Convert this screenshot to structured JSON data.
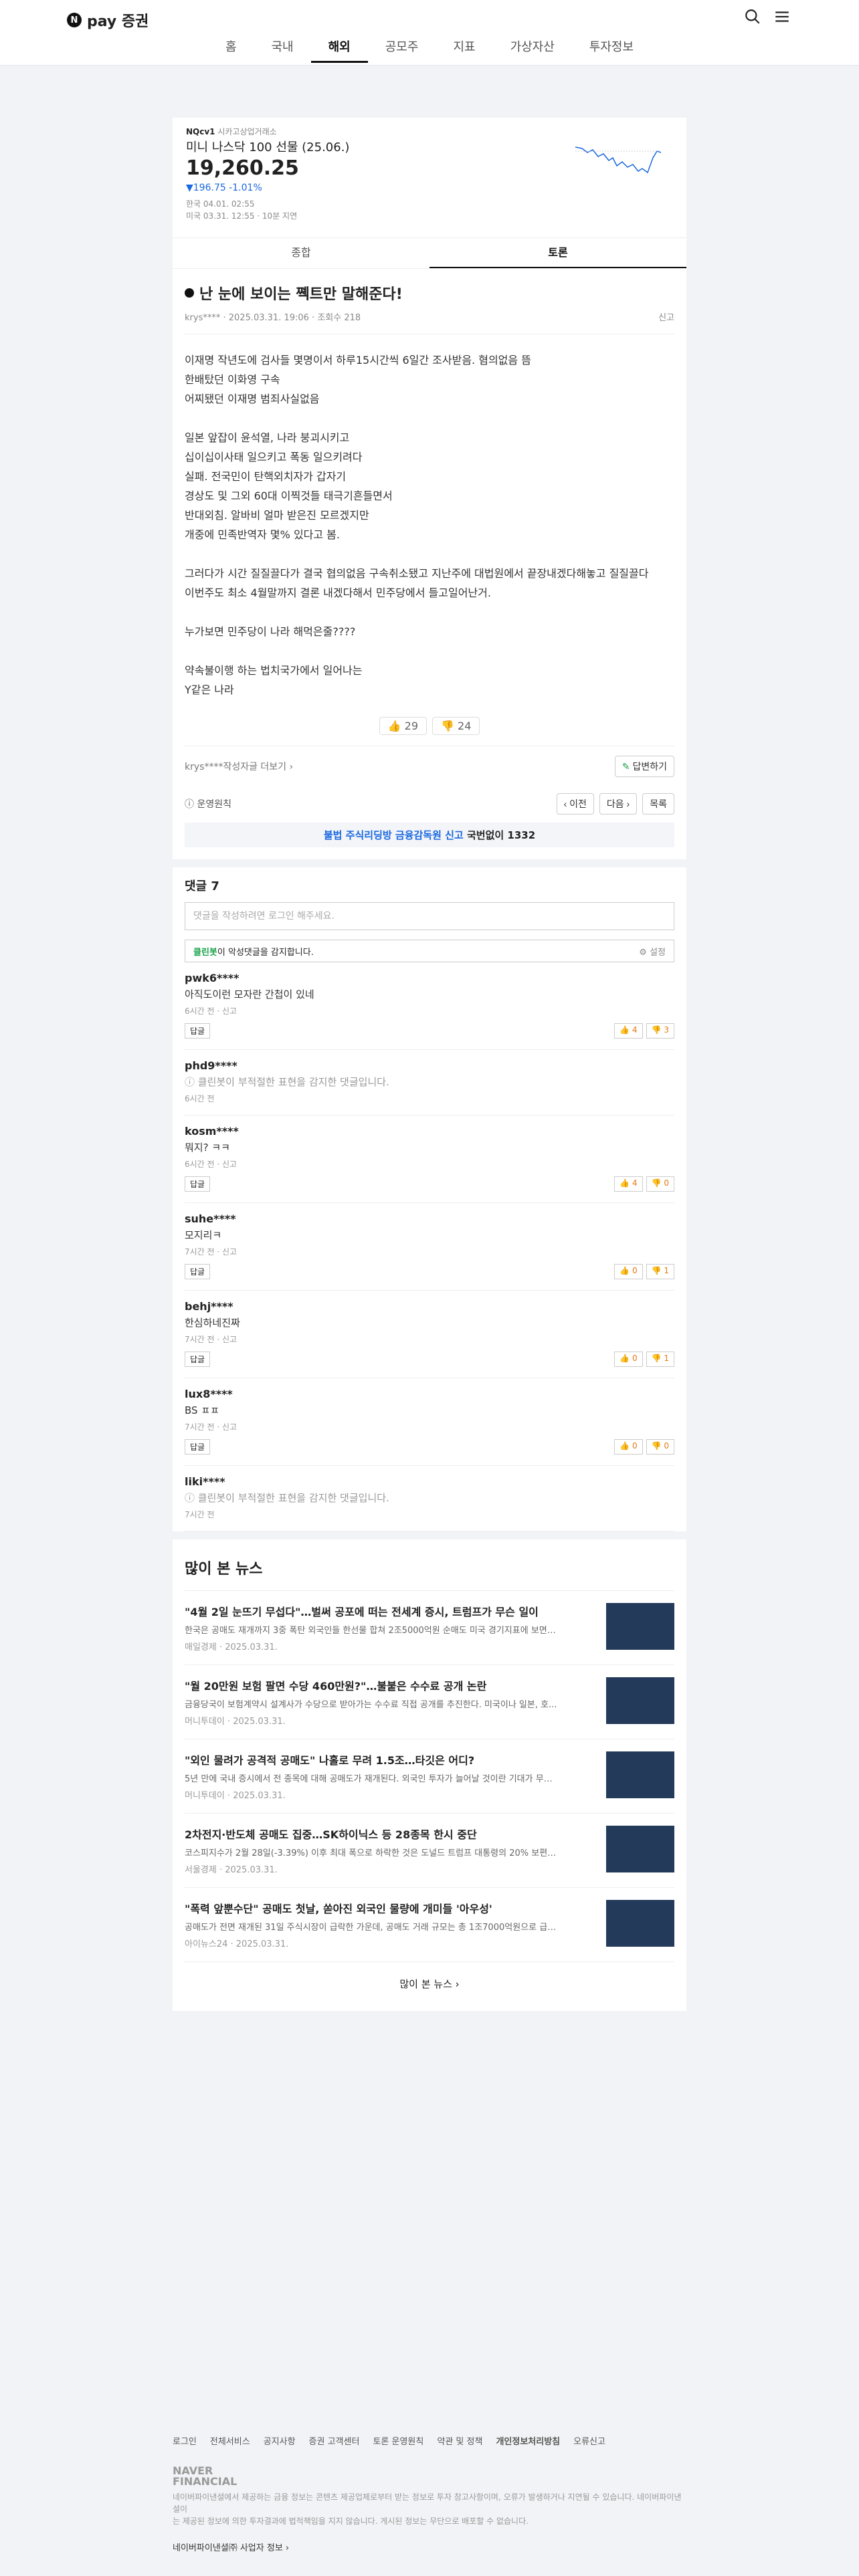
{
  "brand": {
    "logo_letter": "N",
    "name": "pay 증권"
  },
  "nav": [
    "홈",
    "국내",
    "해외",
    "공모주",
    "지표",
    "가상자산",
    "투자정보"
  ],
  "stock": {
    "code": "NQcv1",
    "tag": "시카고상업거래소",
    "name": "미니 나스닥 100 선물 (25.06.)",
    "price": "19,260.25",
    "change": "▼196.75",
    "rate": "-1.01%",
    "time_kr": "한국 04.01. 02:55",
    "time_us": "미국 03.31. 12:55",
    "delay": "10분 지연",
    "line_color": "#1a68e0"
  },
  "tabs": [
    "종합",
    "토론"
  ],
  "post": {
    "title": "난 눈에 보이는 쪡트만 말해준다!",
    "author": "krys****",
    "date": "2025.03.31. 19:06",
    "views": "조회수 218",
    "report": "신고",
    "body": "이재명 작년도에 검사들 몇명이서 하루15시간씩 6일간 조사받음. 혐의없음 뜸\n한배탔던 이화영 구속\n어찌됐던 이재명 범죄사실없음\n\n일본 앞잡이 윤석열, 나라 붕괴시키고\n십이십이사태 일으키고 폭동 일으키려다\n실패. 전국민이 탄핵외치자가 갑자기\n경상도 및 그외 60대 이찍것들 태극기흔들면서\n반대외침. 알바비 얼마 받은진 모르겠지만\n개중에 민족반역자 몇% 있다고 봄.\n\n그러다가 시간 질질끌다가 결국 협의없음 구속취소됐고 지난주에 대법원에서 끝장내겠다해놓고 질질끌다\n이번주도 최소 4월말까지 결론 내겠다해서 민주당에서 들고일어난거.\n\n누가보면 민주당이 나라 해먹은줄????\n\n약속불이행 하는 법치국가에서 일어나는\nY같은 나라",
    "up": "29",
    "down": "24",
    "more": "krys****작성자글 더보기",
    "reply": "답변하기",
    "policy": "운영원칙",
    "prev": "이전",
    "next": "다음",
    "list": "목록",
    "warn_a": "불법 주식리딩방 금융감독원 신고",
    "warn_b": "국번없이 1332"
  },
  "comments": {
    "title": "댓글 7",
    "placeholder": "댓글을 작성하려면 로그인 해주세요.",
    "clean": "클린봇",
    "clean_text": "이 악성댓글을 감지합니다.",
    "setting": "설정",
    "items": [
      {
        "user": "pwk6****",
        "text": "아직도이런 모자란 간첩이 있네",
        "time": "6시간 전 · 신고",
        "reply": "답글",
        "up": "4",
        "down": "3"
      },
      {
        "user": "phd9****",
        "text": "ⓘ 클린봇이 부적절한 표현을 감지한 댓글입니다.",
        "time": "6시간 전",
        "hidden": true
      },
      {
        "user": "kosm****",
        "text": "뭐지? ㅋㅋ",
        "time": "6시간 전 · 신고",
        "reply": "답글",
        "up": "4",
        "down": "0"
      },
      {
        "user": "suhe****",
        "text": "모지리ㅋ",
        "time": "7시간 전 · 신고",
        "reply": "답글",
        "up": "0",
        "down": "1"
      },
      {
        "user": "behj****",
        "text": "한심하네진짜",
        "time": "7시간 전 · 신고",
        "reply": "답글",
        "up": "0",
        "down": "1"
      },
      {
        "user": "lux8****",
        "text": "BS ㅍㅍ",
        "time": "7시간 전 · 신고",
        "reply": "답글",
        "up": "0",
        "down": "0"
      },
      {
        "user": "liki****",
        "text": "ⓘ 클린봇이 부적절한 표현을 감지한 댓글입니다.",
        "time": "7시간 전",
        "hidden": true
      }
    ]
  },
  "news": {
    "title": "많이 본 뉴스",
    "more": "많이 본 뉴스",
    "items": [
      {
        "t": "\"4월 2일 눈뜨기 무섭다\"…벌써 공포에 떠는 전세계 증시, 트럼프가 무슨 일이",
        "d": "한국은 공매도 재개까지 3중 폭탄 외국인들 한선물 합쳐 2조5000억원 순매도 미국 경기지표에 보면관세...",
        "s": "매일경제 · 2025.03.31."
      },
      {
        "t": "\"월 20만원 보험 팔면 수당 460만원?\"…불붙은 수수료 공개 논란",
        "d": "금융당국이 보험계약시 설계사가 수당으로 받아가는 수수료 직접 공개를 추진한다. 미국이나 일본, 호...",
        "s": "머니투데이 · 2025.03.31."
      },
      {
        "t": "\"외인 물려가 공격적 공매도\" 나홀로 무려 1.5조…타깃은 어디?",
        "d": "5년 만에 국내 증시에서 전 종목에 대해 공매도가 재개된다. 외국인 투자가 늘어날 것이란 기대가 무색하...",
        "s": "머니투데이 · 2025.03.31."
      },
      {
        "t": "2차전지·반도체 공매도 집중…SK하이닉스 등 28종목 한시 중단",
        "d": "코스피지수가 2월 28일(-3.39%) 이후 최대 폭으로 하락한 것은 도널드 트럼프 대통령의 20% 보편관세 ...",
        "s": "서울경제 · 2025.03.31."
      },
      {
        "t": "\"폭력 앞뿐수단\" 공매도 첫날, 쏟아진 외국인 물량에 개미들 '아우성'",
        "d": "공매도가 전면 재개된 31일 주식시장이 급락한 가운데, 공매도 거래 규모는 총 1조7000억원으로 급지 ...",
        "s": "아이뉴스24 · 2025.03.31."
      }
    ]
  },
  "footer": {
    "links": [
      "로그인",
      "전체서비스",
      "공지사항",
      "증권 고객센터",
      "토론 운영원칙",
      "약관 및 정책",
      "개인정보처리방침",
      "오류신고"
    ],
    "brand1": "NAVER",
    "brand2": "FINANCIAL",
    "desc": "네이버파이낸셜에서 제공하는 금융 정보는 콘텐츠 제공업체로부터 받는 정보로 투자 참고사항이며, 오류가 발생하거나 지연될 수 있습니다. 네이버파이낸셜이\n는 제공된 정보에 의한 투자결과에 법적책임을 지지 않습니다. 게시된 정보는 무단으로 배포할 수 없습니다.",
    "info": "네이버파이낸셜㈜ 사업자 정보 ›"
  }
}
